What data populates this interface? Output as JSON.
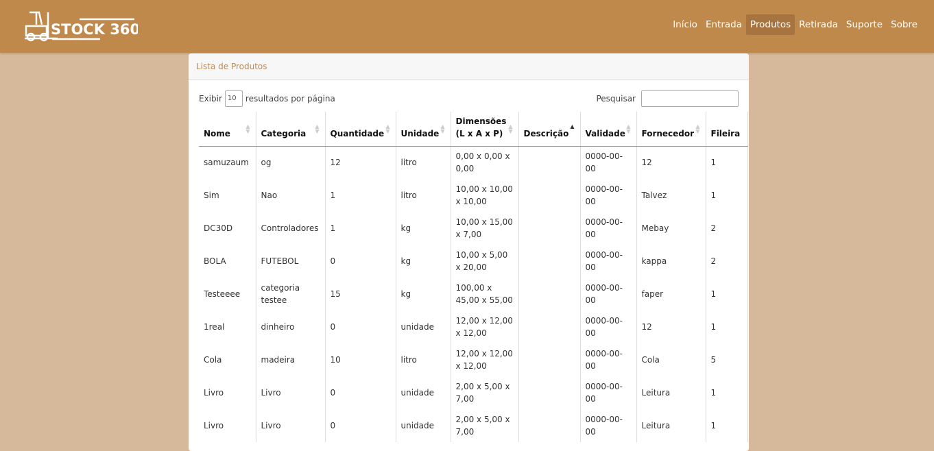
{
  "brand": {
    "name": "STOCK 360"
  },
  "nav": {
    "items": [
      {
        "label": "Início"
      },
      {
        "label": "Entrada"
      },
      {
        "label": "Produtos",
        "active": true
      },
      {
        "label": "Retirada"
      },
      {
        "label": "Suporte"
      },
      {
        "label": "Sobre"
      }
    ]
  },
  "card": {
    "title": "Lista de Produtos"
  },
  "controls": {
    "show_prefix": "Exibir",
    "page_length": "10",
    "show_suffix": "resultados por página",
    "search_label": "Pesquisar",
    "search_value": ""
  },
  "table": {
    "columns": [
      "Nome",
      "Categoria",
      "Quantidade",
      "Unidade",
      "Dimensões (L x A x P)",
      "Descrição",
      "Validade",
      "Fornecedor",
      "Fileira"
    ],
    "sorted_column": "Descrição",
    "sort_direction": "asc",
    "rows": [
      [
        "samuzaum",
        "og",
        "12",
        "litro",
        "0,00 x 0,00 x 0,00",
        "",
        "0000-00-00",
        "12",
        "1"
      ],
      [
        "Sim",
        "Nao",
        "1",
        "litro",
        "10,00 x 10,00 x 10,00",
        "",
        "0000-00-00",
        "Talvez",
        "1"
      ],
      [
        "DC30D",
        "Controladores",
        "1",
        "kg",
        "10,00 x 15,00 x 7,00",
        "",
        "0000-00-00",
        "Mebay",
        "2"
      ],
      [
        "BOLA",
        "FUTEBOL",
        "0",
        "kg",
        "10,00 x 5,00 x 20,00",
        "",
        "0000-00-00",
        "kappa",
        "2"
      ],
      [
        "Testeeee",
        "categoria testee",
        "15",
        "kg",
        "100,00 x 45,00 x 55,00",
        "",
        "0000-00-00",
        "faper",
        "1"
      ],
      [
        "1real",
        "dinheiro",
        "0",
        "unidade",
        "12,00 x 12,00 x 12,00",
        "",
        "0000-00-00",
        "12",
        "1"
      ],
      [
        "Cola",
        "madeira",
        "10",
        "litro",
        "12,00 x 12,00 x 12,00",
        "",
        "0000-00-00",
        "Cola",
        "5"
      ],
      [
        "Livro",
        "Livro",
        "0",
        "unidade",
        "2,00 x 5,00 x 7,00",
        "",
        "0000-00-00",
        "Leitura",
        "1"
      ],
      [
        "Livro",
        "Livro",
        "0",
        "unidade",
        "2,00 x 5,00 x 7,00",
        "",
        "0000-00-00",
        "Leitura",
        "1"
      ]
    ]
  },
  "colors": {
    "navbar": "#bf894b",
    "active_nav": "#a7743f",
    "background": "#d6b99a"
  }
}
